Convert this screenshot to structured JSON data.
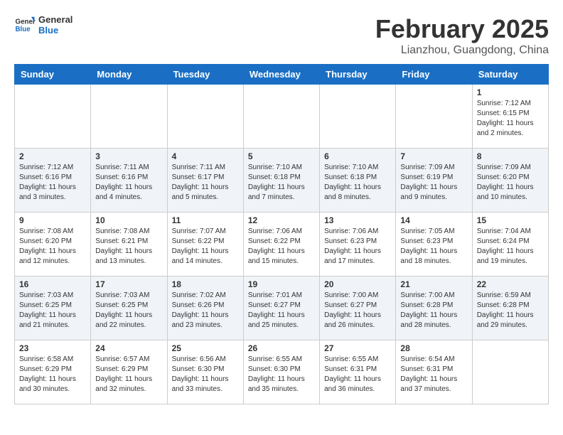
{
  "header": {
    "logo_general": "General",
    "logo_blue": "Blue",
    "month_title": "February 2025",
    "subtitle": "Lianzhou, Guangdong, China"
  },
  "days_of_week": [
    "Sunday",
    "Monday",
    "Tuesday",
    "Wednesday",
    "Thursday",
    "Friday",
    "Saturday"
  ],
  "weeks": [
    [
      {
        "day": "",
        "info": ""
      },
      {
        "day": "",
        "info": ""
      },
      {
        "day": "",
        "info": ""
      },
      {
        "day": "",
        "info": ""
      },
      {
        "day": "",
        "info": ""
      },
      {
        "day": "",
        "info": ""
      },
      {
        "day": "1",
        "info": "Sunrise: 7:12 AM\nSunset: 6:15 PM\nDaylight: 11 hours\nand 2 minutes."
      }
    ],
    [
      {
        "day": "2",
        "info": "Sunrise: 7:12 AM\nSunset: 6:16 PM\nDaylight: 11 hours\nand 3 minutes."
      },
      {
        "day": "3",
        "info": "Sunrise: 7:11 AM\nSunset: 6:16 PM\nDaylight: 11 hours\nand 4 minutes."
      },
      {
        "day": "4",
        "info": "Sunrise: 7:11 AM\nSunset: 6:17 PM\nDaylight: 11 hours\nand 5 minutes."
      },
      {
        "day": "5",
        "info": "Sunrise: 7:10 AM\nSunset: 6:18 PM\nDaylight: 11 hours\nand 7 minutes."
      },
      {
        "day": "6",
        "info": "Sunrise: 7:10 AM\nSunset: 6:18 PM\nDaylight: 11 hours\nand 8 minutes."
      },
      {
        "day": "7",
        "info": "Sunrise: 7:09 AM\nSunset: 6:19 PM\nDaylight: 11 hours\nand 9 minutes."
      },
      {
        "day": "8",
        "info": "Sunrise: 7:09 AM\nSunset: 6:20 PM\nDaylight: 11 hours\nand 10 minutes."
      }
    ],
    [
      {
        "day": "9",
        "info": "Sunrise: 7:08 AM\nSunset: 6:20 PM\nDaylight: 11 hours\nand 12 minutes."
      },
      {
        "day": "10",
        "info": "Sunrise: 7:08 AM\nSunset: 6:21 PM\nDaylight: 11 hours\nand 13 minutes."
      },
      {
        "day": "11",
        "info": "Sunrise: 7:07 AM\nSunset: 6:22 PM\nDaylight: 11 hours\nand 14 minutes."
      },
      {
        "day": "12",
        "info": "Sunrise: 7:06 AM\nSunset: 6:22 PM\nDaylight: 11 hours\nand 15 minutes."
      },
      {
        "day": "13",
        "info": "Sunrise: 7:06 AM\nSunset: 6:23 PM\nDaylight: 11 hours\nand 17 minutes."
      },
      {
        "day": "14",
        "info": "Sunrise: 7:05 AM\nSunset: 6:23 PM\nDaylight: 11 hours\nand 18 minutes."
      },
      {
        "day": "15",
        "info": "Sunrise: 7:04 AM\nSunset: 6:24 PM\nDaylight: 11 hours\nand 19 minutes."
      }
    ],
    [
      {
        "day": "16",
        "info": "Sunrise: 7:03 AM\nSunset: 6:25 PM\nDaylight: 11 hours\nand 21 minutes."
      },
      {
        "day": "17",
        "info": "Sunrise: 7:03 AM\nSunset: 6:25 PM\nDaylight: 11 hours\nand 22 minutes."
      },
      {
        "day": "18",
        "info": "Sunrise: 7:02 AM\nSunset: 6:26 PM\nDaylight: 11 hours\nand 23 minutes."
      },
      {
        "day": "19",
        "info": "Sunrise: 7:01 AM\nSunset: 6:27 PM\nDaylight: 11 hours\nand 25 minutes."
      },
      {
        "day": "20",
        "info": "Sunrise: 7:00 AM\nSunset: 6:27 PM\nDaylight: 11 hours\nand 26 minutes."
      },
      {
        "day": "21",
        "info": "Sunrise: 7:00 AM\nSunset: 6:28 PM\nDaylight: 11 hours\nand 28 minutes."
      },
      {
        "day": "22",
        "info": "Sunrise: 6:59 AM\nSunset: 6:28 PM\nDaylight: 11 hours\nand 29 minutes."
      }
    ],
    [
      {
        "day": "23",
        "info": "Sunrise: 6:58 AM\nSunset: 6:29 PM\nDaylight: 11 hours\nand 30 minutes."
      },
      {
        "day": "24",
        "info": "Sunrise: 6:57 AM\nSunset: 6:29 PM\nDaylight: 11 hours\nand 32 minutes."
      },
      {
        "day": "25",
        "info": "Sunrise: 6:56 AM\nSunset: 6:30 PM\nDaylight: 11 hours\nand 33 minutes."
      },
      {
        "day": "26",
        "info": "Sunrise: 6:55 AM\nSunset: 6:30 PM\nDaylight: 11 hours\nand 35 minutes."
      },
      {
        "day": "27",
        "info": "Sunrise: 6:55 AM\nSunset: 6:31 PM\nDaylight: 11 hours\nand 36 minutes."
      },
      {
        "day": "28",
        "info": "Sunrise: 6:54 AM\nSunset: 6:31 PM\nDaylight: 11 hours\nand 37 minutes."
      },
      {
        "day": "",
        "info": ""
      }
    ]
  ]
}
